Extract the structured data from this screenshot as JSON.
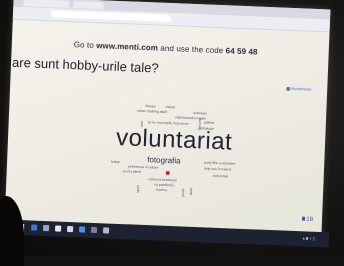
{
  "instruction": {
    "prefix": "Go to ",
    "url": "www.menti.com",
    "middle": " and use the code ",
    "code": "64 59 48"
  },
  "question": "are sunt hobby-urile tale?",
  "brand": "Mentimeter",
  "wordcloud": {
    "big": "voluntariat",
    "mid": "fotografia",
    "small": [
      "filmare",
      "vizitari",
      "citesc tracking adult",
      "voluntariatul cu copii",
      "activitate",
      "sa nu mai implic in proiecte",
      "politica",
      "psihologie",
      "fotbal",
      "petrecerea in nature",
      "party like a volunteer",
      "timp sau în natură",
      "sa ma plimb",
      "concertele",
      "citirea la benzinarii",
      "ca pandemia",
      "muzica",
      "sport",
      "dans",
      "excursii",
      "arta",
      "jocuri"
    ]
  },
  "responses_count": "18",
  "colors": {
    "accent": "#5b6bd0",
    "heart": "#c9264b"
  }
}
